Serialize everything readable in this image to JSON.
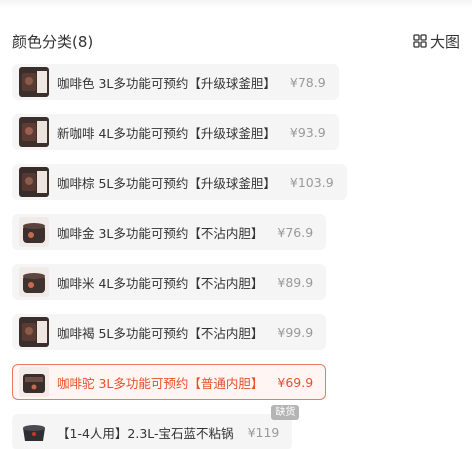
{
  "header": {
    "title": "颜色分类(8)",
    "view_label": "大图"
  },
  "colors": {
    "accent": "#e4502b",
    "selected_border": "#ec7a5e",
    "price_gray": "#999999",
    "option_bg": "#f5f5f5"
  },
  "options": [
    {
      "name": "咖啡色 3L多功能可预约【升级球釜胆】",
      "price": "¥78.9",
      "selected": false
    },
    {
      "name": "新咖啡 4L多功能可预约【升级球釜胆】",
      "price": "¥93.9",
      "selected": false
    },
    {
      "name": "咖啡棕 5L多功能可预约【升级球釜胆】",
      "price": "¥103.9",
      "selected": false
    },
    {
      "name": "咖啡金 3L多功能可预约【不沾内胆】",
      "price": "¥76.9",
      "selected": false
    },
    {
      "name": "咖啡米 4L多功能可预约【不沾内胆】",
      "price": "¥89.9",
      "selected": false
    },
    {
      "name": "咖啡褐 5L多功能可预约【不沾内胆】",
      "price": "¥99.9",
      "selected": false
    },
    {
      "name": "咖啡驼 3L多功能可预约【普通内胆】",
      "price": "¥69.9",
      "selected": true
    },
    {
      "name": "【1-4人用】2.3L-宝石蓝不粘锅",
      "price": "¥119",
      "selected": false,
      "badge": "缺货"
    }
  ]
}
